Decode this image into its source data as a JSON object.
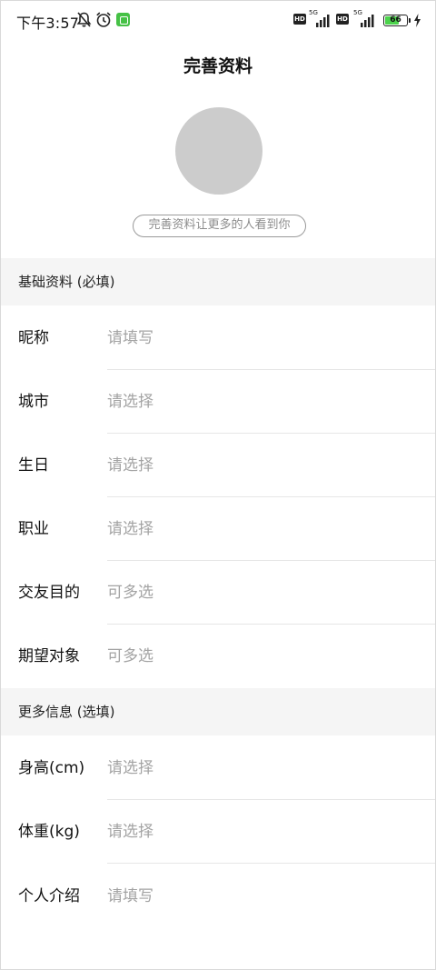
{
  "status_bar": {
    "time": "下午3:57",
    "network_label": "5G",
    "hd_label": "HD",
    "battery_level": "66",
    "battery_percent": 66,
    "icons": [
      "bell-muted-icon",
      "alarm-icon",
      "app-notification-icon",
      "signal-icon",
      "battery-icon",
      "charging-icon"
    ]
  },
  "header": {
    "title": "完善资料"
  },
  "avatar": {
    "tip": "完善资料让更多的人看到你"
  },
  "basic": {
    "title": "基础资料 (必填)",
    "rows": [
      {
        "label": "昵称",
        "value": "请填写"
      },
      {
        "label": "城市",
        "value": "请选择"
      },
      {
        "label": "生日",
        "value": "请选择"
      },
      {
        "label": "职业",
        "value": "请选择"
      },
      {
        "label": "交友目的",
        "value": "可多选"
      },
      {
        "label": "期望对象",
        "value": "可多选"
      }
    ]
  },
  "more": {
    "title": "更多信息 (选填)",
    "rows": [
      {
        "label": "身高(cm)",
        "value": "请选择"
      },
      {
        "label": "体重(kg)",
        "value": "请选择"
      },
      {
        "label": "个人介绍",
        "value": "请填写"
      }
    ]
  },
  "colors": {
    "avatar_bg": "#cccccc",
    "section_bg": "#f5f5f5",
    "placeholder": "#a3a3a3",
    "battery": "#4cd34c"
  }
}
